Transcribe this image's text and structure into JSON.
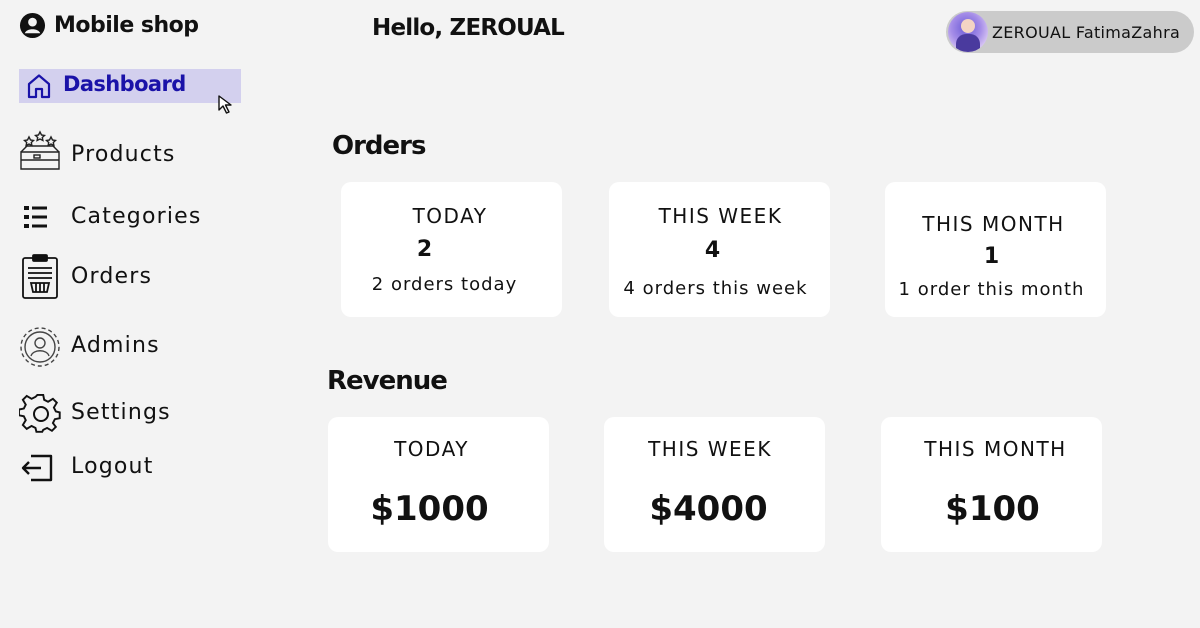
{
  "app": {
    "title": "Mobile shop",
    "icon": "user-circle-icon"
  },
  "header": {
    "greeting": "Hello, ZEROUAL",
    "user_name": "ZEROUAL FatimaZahra"
  },
  "sidebar": {
    "items": [
      {
        "label": "Dashboard",
        "icon": "home-icon",
        "active": true
      },
      {
        "label": "Products",
        "icon": "box-icon"
      },
      {
        "label": "Categories",
        "icon": "list-icon"
      },
      {
        "label": "Orders",
        "icon": "clipboard-icon"
      },
      {
        "label": "Admins",
        "icon": "admin-icon"
      },
      {
        "label": "Settings",
        "icon": "gear-icon"
      },
      {
        "label": "Logout",
        "icon": "logout-icon"
      }
    ]
  },
  "orders": {
    "title": "Orders",
    "cards": [
      {
        "period": "TODAY",
        "count": "2",
        "desc": "2 orders today"
      },
      {
        "period": "THIS WEEK",
        "count": "4",
        "desc": "4 orders this week"
      },
      {
        "period": "THIS MONTH",
        "count": "1",
        "desc": "1 order this month"
      }
    ]
  },
  "revenue": {
    "title": "Revenue",
    "cards": [
      {
        "period": "TODAY",
        "amount": "$1000"
      },
      {
        "period": "THIS WEEK",
        "amount": "$4000"
      },
      {
        "period": "THIS MONTH",
        "amount": "$100"
      }
    ]
  },
  "colors": {
    "background": "#f3f3f3",
    "active_nav_bg": "#d3d0ee",
    "active_nav_text": "#1a12a8",
    "card_bg": "#ffffff",
    "user_pill": "#cbcbcb"
  }
}
